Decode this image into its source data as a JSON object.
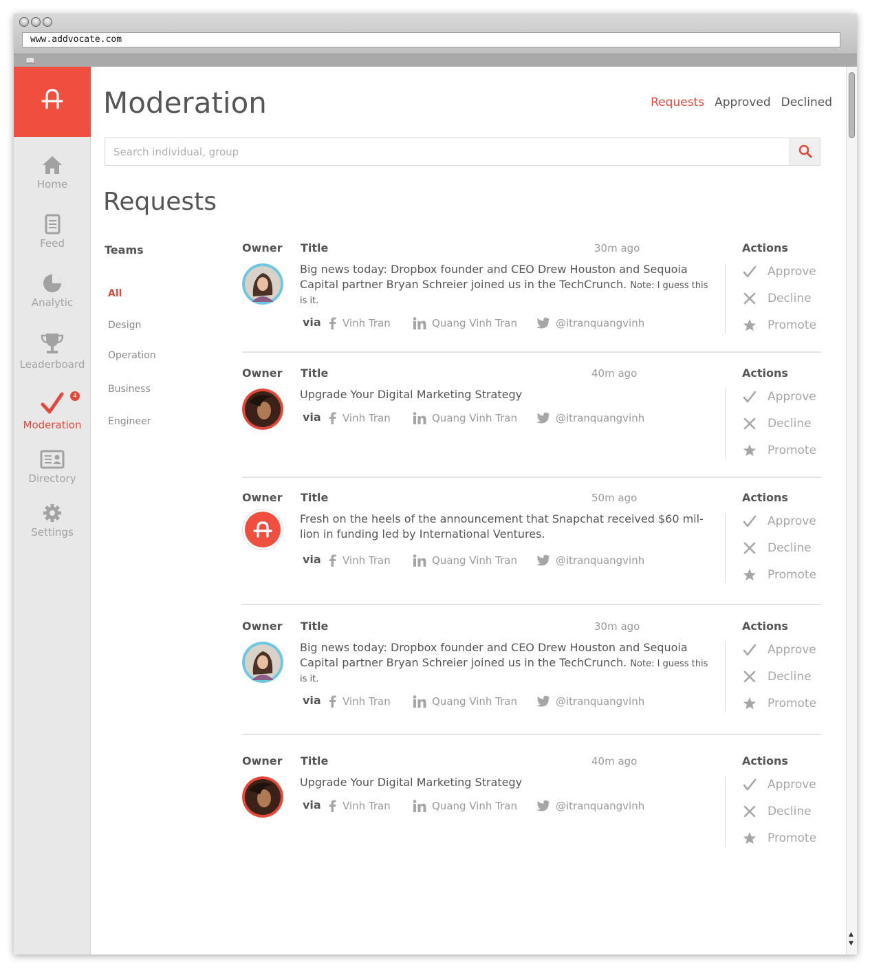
{
  "browser": {
    "url": "www.addvocate.com",
    "bookmarks_icon": "book-icon"
  },
  "brand": {
    "accent": "#f04e3e",
    "active_text": "#e5473a"
  },
  "sidebar": {
    "items": [
      {
        "label": "Home",
        "icon": "home-icon"
      },
      {
        "label": "Feed",
        "icon": "document-icon"
      },
      {
        "label": "Analytic",
        "icon": "pie-chart-icon"
      },
      {
        "label": "Leaderboard",
        "icon": "trophy-icon"
      },
      {
        "label": "Moderation",
        "icon": "checkmark-icon",
        "badge": "4",
        "active": true
      },
      {
        "label": "Directory",
        "icon": "contact-card-icon"
      },
      {
        "label": "Settings",
        "icon": "gear-icon"
      }
    ]
  },
  "header": {
    "title": "Moderation",
    "tabs": [
      "Requests",
      "Approved",
      "Declined"
    ],
    "active_tab": "Requests"
  },
  "search": {
    "placeholder": "Search individual, group",
    "value": "",
    "icon": "search-icon"
  },
  "section_title": "Requests",
  "teams": {
    "heading": "Teams",
    "items": [
      "All",
      "Design",
      "Operation",
      "Business",
      "Engineer"
    ],
    "active": "All"
  },
  "columns": {
    "owner": "Owner",
    "title": "Title",
    "actions": "Actions"
  },
  "via_label": "via",
  "actions": [
    "Approve",
    "Decline",
    "Promote"
  ],
  "posts": [
    {
      "time": "30m ago",
      "owner_avatar": "avatar-woman-blue-ring",
      "text": "Big news today: Dropbox founder and CEO Drew Houston and Sequoia Capital partner Bryan Schreier joined us in the TechCrunch.",
      "note": "Note: I guess this is it.",
      "sources": [
        "Vinh Tran",
        "Quang Vinh Tran",
        "@itranquangvinh"
      ]
    },
    {
      "time": "40m ago",
      "owner_avatar": "avatar-woman-red-ring",
      "text": "Upgrade Your Digital Marketing Strategy",
      "note": "",
      "sources": [
        "Vinh Tran",
        "Quang Vinh Tran",
        "@itranquangvinh"
      ]
    },
    {
      "time": "50m ago",
      "owner_avatar": "avatar-addvocate-logo",
      "text": "Fresh on the heels of the announcement that Snapchat received $60 mil-lion in funding led by International Ventures.",
      "note": "",
      "sources": [
        "Vinh Tran",
        "Quang Vinh Tran",
        "@itranquangvinh"
      ]
    },
    {
      "time": "30m ago",
      "owner_avatar": "avatar-woman-blue-ring",
      "text": "Big news today: Dropbox founder and CEO Drew Houston and Sequoia Capital partner Bryan Schreier joined us in the TechCrunch.",
      "note": "Note: I guess this is it.",
      "sources": [
        "Vinh Tran",
        "Quang Vinh Tran",
        "@itranquangvinh"
      ]
    },
    {
      "time": "40m ago",
      "owner_avatar": "avatar-woman-red-ring",
      "text": "Upgrade Your Digital Marketing Strategy",
      "note": "",
      "sources": [
        "Vinh Tran",
        "Quang Vinh Tran",
        "@itranquangvinh"
      ]
    }
  ]
}
